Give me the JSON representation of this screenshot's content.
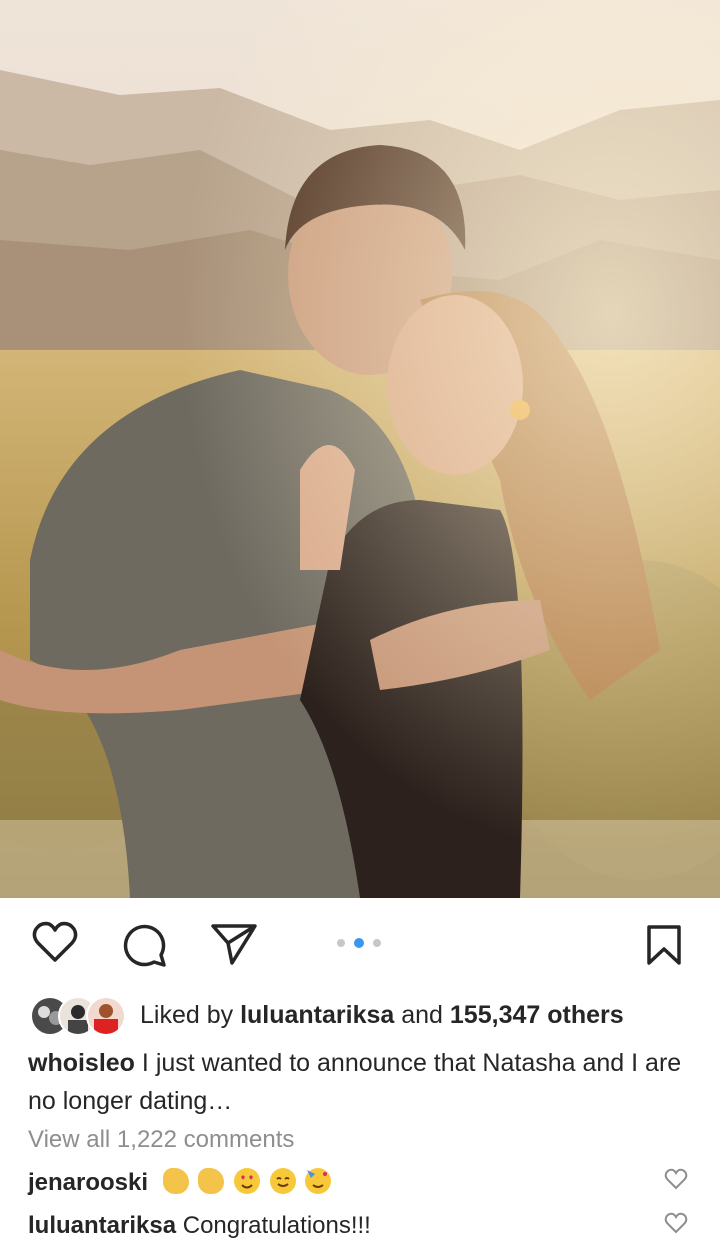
{
  "post": {
    "image_alt": "Engaged couple smiling and embracing in a sunlit mountain meadow; woman shows ring",
    "carousel": {
      "count": 3,
      "active_index": 1
    }
  },
  "actions": {
    "like_icon": "heart-outline-icon",
    "comment_icon": "comment-bubble-icon",
    "share_icon": "paper-plane-icon",
    "save_icon": "bookmark-icon"
  },
  "likes": {
    "prefix": "Liked by ",
    "user": "luluantariksa",
    "middle": " and ",
    "count": "155,347 others"
  },
  "caption": {
    "username": "whoisleo",
    "text": "I just wanted to announce that Natasha and I are no longer dating…"
  },
  "view_all_comments": "View all 1,222 comments",
  "comments": [
    {
      "username": "jenarooski",
      "text": "",
      "emojis": [
        "clapping-hands",
        "clapping-hands",
        "heart-eyes",
        "smiling-face",
        "party-face"
      ]
    },
    {
      "username": "luluantariksa",
      "text": "Congratulations!!!"
    }
  ],
  "colors": {
    "accent": "#3897f0",
    "text": "#262626",
    "muted": "#8e8e8e"
  }
}
